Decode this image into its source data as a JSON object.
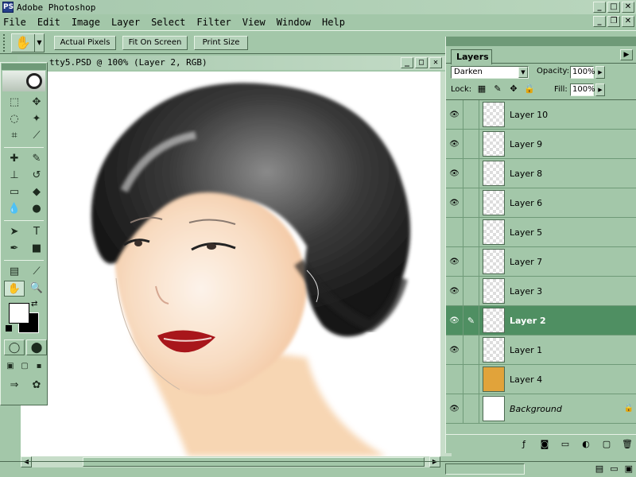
{
  "window": {
    "title": "Adobe Photoshop",
    "app_icon": "PS",
    "min": "_",
    "max": "□",
    "close": "✕"
  },
  "menu": [
    "File",
    "Edit",
    "Image",
    "Layer",
    "Select",
    "Filter",
    "View",
    "Window",
    "Help"
  ],
  "menu_right": {
    "min": "_",
    "restore": "❐",
    "close": "✕"
  },
  "options": {
    "tool_icon": "hand-icon",
    "actual_pixels": "Actual Pixels",
    "fit_on_screen": "Fit On Screen",
    "print_size": "Print Size"
  },
  "document": {
    "title": "tty5.PSD @ 100% (Layer 2, RGB)",
    "min": "_",
    "max": "□",
    "close": "✕"
  },
  "layers_palette": {
    "tab": "Layers",
    "blend_mode": "Darken",
    "opacity_label": "Opacity:",
    "opacity": "100%",
    "lock_label": "Lock:",
    "fill_label": "Fill:",
    "fill": "100%",
    "layers": [
      {
        "name": "Layer 10",
        "visible": true,
        "thumb": "checker"
      },
      {
        "name": "Layer 9",
        "visible": true,
        "thumb": "checker"
      },
      {
        "name": "Layer 8",
        "visible": true,
        "thumb": "checker"
      },
      {
        "name": "Layer 6",
        "visible": true,
        "thumb": "checker"
      },
      {
        "name": "Layer 5",
        "visible": false,
        "thumb": "checker"
      },
      {
        "name": "Layer 7",
        "visible": true,
        "thumb": "checker"
      },
      {
        "name": "Layer 3",
        "visible": true,
        "thumb": "checker"
      },
      {
        "name": "Layer 2",
        "visible": true,
        "thumb": "checker",
        "active": true
      },
      {
        "name": "Layer 1",
        "visible": true,
        "thumb": "checker"
      },
      {
        "name": "Layer 4",
        "visible": false,
        "thumb": "yellow"
      },
      {
        "name": "Background",
        "visible": true,
        "thumb": "white",
        "locked": true
      }
    ]
  },
  "colors": {
    "accent": "#4f8f62",
    "panel": "#a3c7a9",
    "foreground": "#ffffff",
    "background": "#000000"
  }
}
